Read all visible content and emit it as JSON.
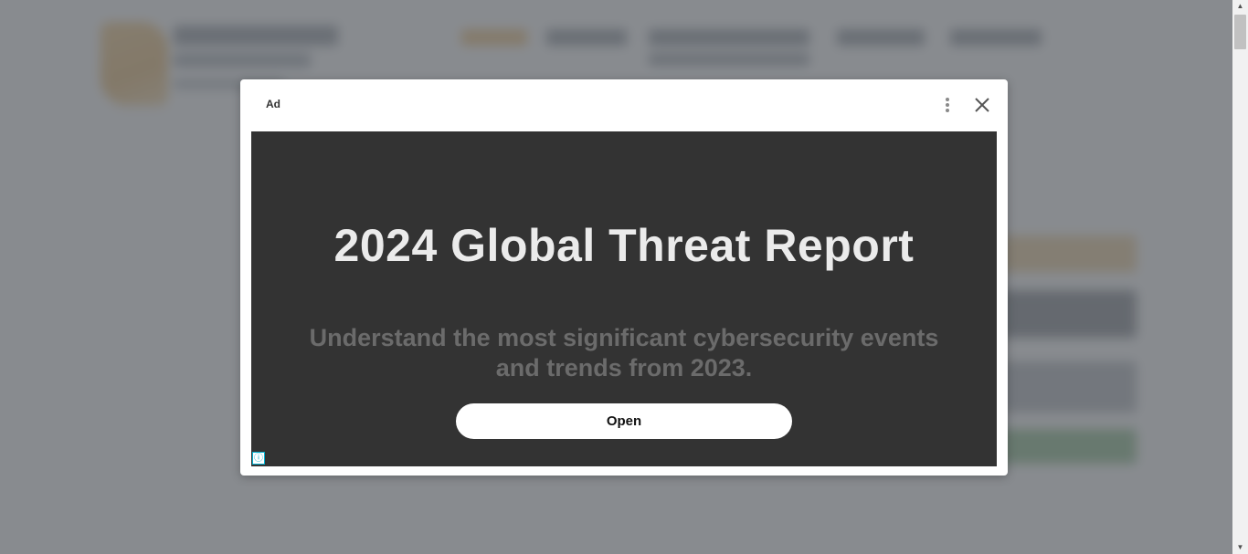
{
  "ad_dialog": {
    "ad_label": "Ad",
    "headline": "2024 Global Threat Report",
    "subheadline": "Understand the most significant cybersecurity events and trends from 2023.",
    "cta_label": "Open",
    "info_icon": "ⓘ",
    "icons": {
      "more": "more-vertical-icon",
      "close": "close-icon",
      "info": "info-icon"
    }
  },
  "colors": {
    "overlay": "#6e7276",
    "creative_background": "#333333",
    "headline_text": "#ebebeb",
    "subheadline_text": "#6b6b6b",
    "info_badge": "#00aecd"
  }
}
